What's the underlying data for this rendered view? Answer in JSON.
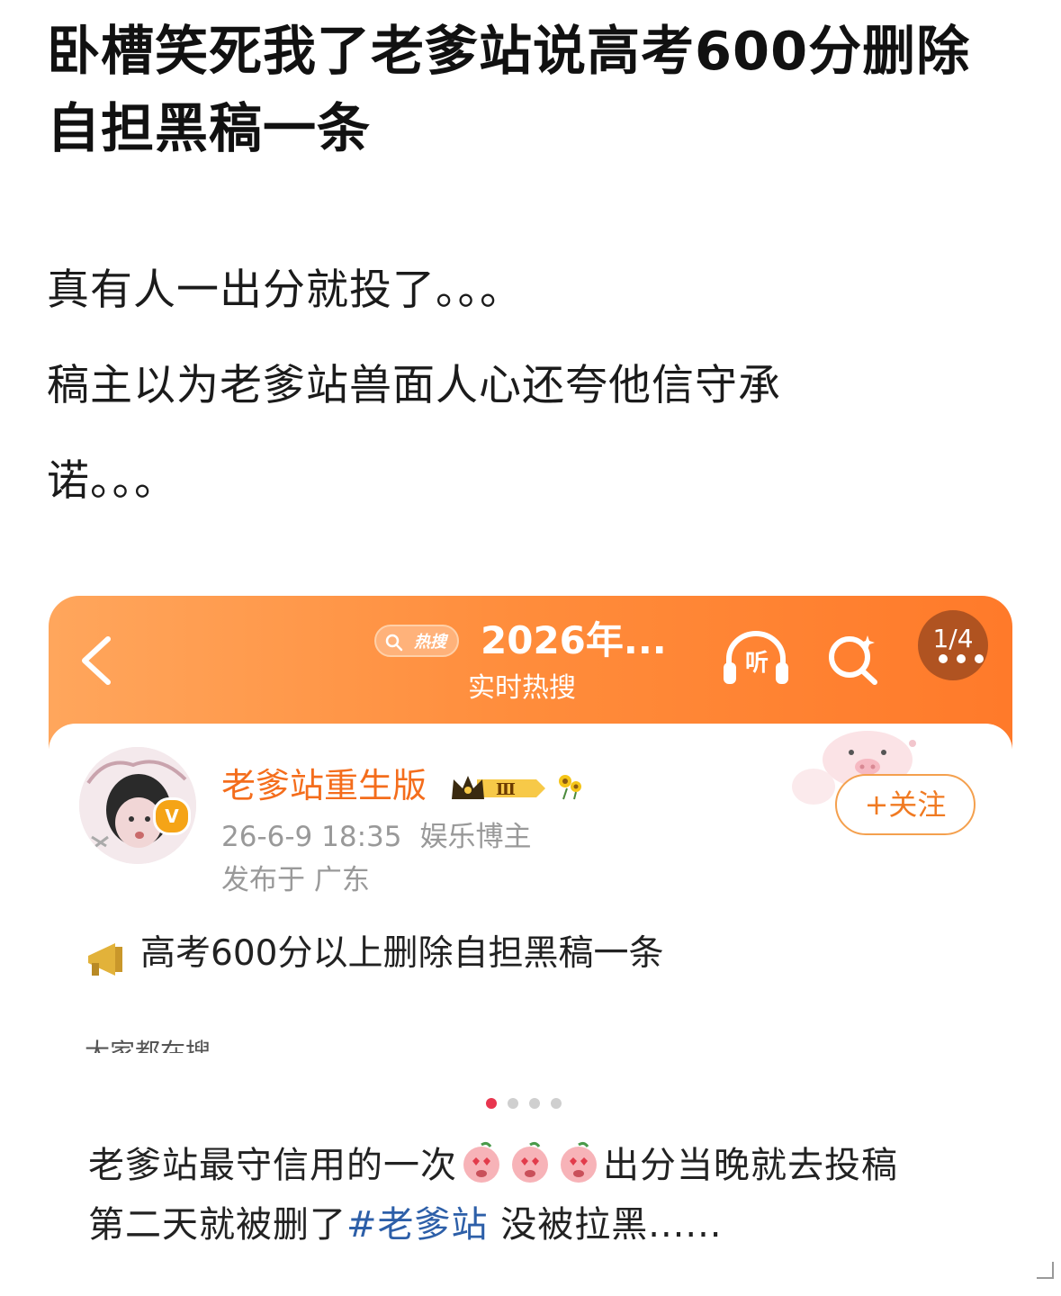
{
  "post": {
    "title": "卧槽笑死我了老爹站说高考600分删除自担黑稿一条",
    "body_lines": [
      "真有人一出分就投了。。。",
      "稿主以为老爹站兽面人心还夸他信守承",
      "诺。。。"
    ]
  },
  "screenshot": {
    "header": {
      "hot_badge": "热搜",
      "hot_title": "2026年...",
      "hot_sub": "实时热搜",
      "listen_label": "听",
      "page_indicator": "1/4"
    },
    "author": {
      "name": "老爹站重生版",
      "level_badge": "Ⅲ",
      "verified_badge": "V",
      "timestamp": "26-6-9 18:35",
      "tag": "娱乐博主",
      "location": "发布于 广东"
    },
    "follow_button": "+关注",
    "post_text": "高考600分以上删除自担黑稿一条",
    "cut_text": "大家都在搜",
    "carousel": {
      "total": 4,
      "active_index": 0
    }
  },
  "caption": {
    "line1_a": "老爹站最守信用的一次",
    "line1_b": "出分当晚就去投稿",
    "line2_a": "第二天就被删了",
    "hashtag": "#老爹站",
    "line2_b": " 没被拉黑......"
  },
  "colors": {
    "header_orange": "#ff8c3b",
    "author_orange": "#f46d1c",
    "hashtag_blue": "#2d5fa8",
    "dot_active": "#e8364f"
  }
}
